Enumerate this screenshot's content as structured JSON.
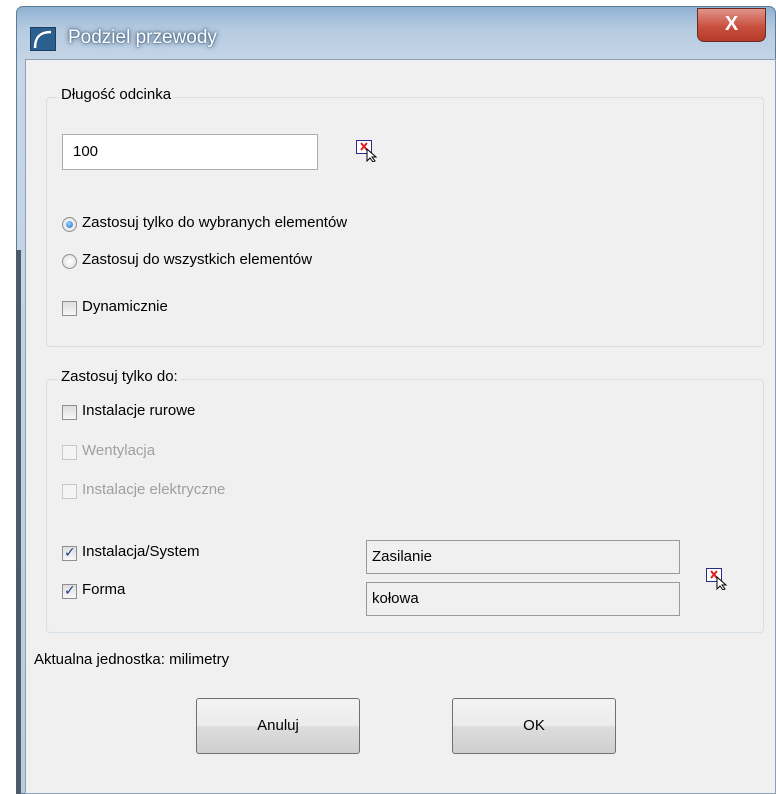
{
  "window": {
    "title": "Podziel przewody",
    "close_label": "X"
  },
  "segment_group": {
    "legend": "Długość odcinka",
    "length_value": "100",
    "apply_options": [
      {
        "label": "Zastosuj tylko do wybranych elementów",
        "selected": true
      },
      {
        "label": "Zastosuj do wszystkich elementów",
        "selected": false
      }
    ],
    "dynamic": {
      "label": "Dynamicznie",
      "checked": false
    }
  },
  "filter_group": {
    "legend": "Zastosuj tylko do:",
    "categories": [
      {
        "label": "Instalacje rurowe",
        "checked": false,
        "enabled": true
      },
      {
        "label": "Wentylacja",
        "checked": false,
        "enabled": false
      },
      {
        "label": "Instalacje elektryczne",
        "checked": false,
        "enabled": false
      }
    ],
    "system": {
      "label": "Instalacja/System",
      "checked": true,
      "value": "Zasilanie"
    },
    "shape": {
      "label": "Forma",
      "checked": true,
      "value": "kołowa"
    }
  },
  "status": {
    "unit_text": "Aktualna jednostka: milimetry"
  },
  "buttons": {
    "cancel": "Anuluj",
    "ok": "OK"
  },
  "icons": {
    "pick": "pick-element-icon",
    "app": "app-icon"
  }
}
